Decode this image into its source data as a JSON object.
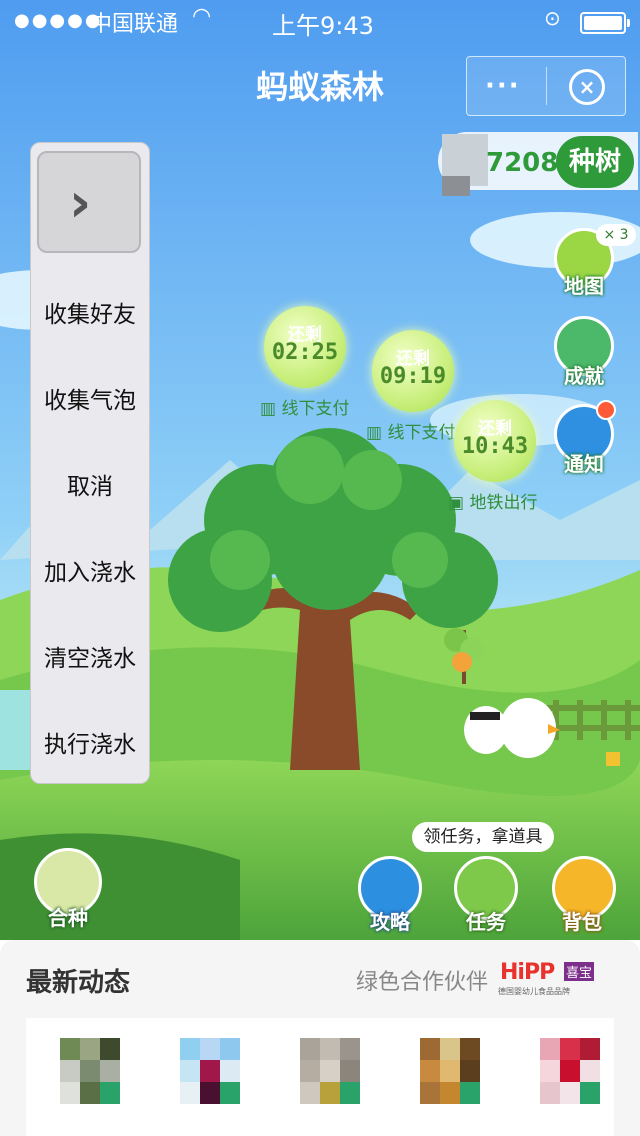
{
  "status_bar": {
    "signal": "●●●●●",
    "carrier": "中国联通",
    "time": "上午9:43"
  },
  "header": {
    "title": "蚂蚁森林",
    "more_label": "···"
  },
  "energy": {
    "value": "7208g",
    "plant_button": "种树"
  },
  "side_buttons": [
    {
      "label": "地图",
      "icon": "tree-icon",
      "badge": "× 3"
    },
    {
      "label": "成就",
      "icon": "certificate-icon"
    },
    {
      "label": "通知",
      "icon": "envelope-icon"
    }
  ],
  "bubbles": [
    {
      "top": "还剩",
      "time": "02:25",
      "note": "线下支付"
    },
    {
      "top": "还剩",
      "time": "09:19",
      "note": "线下支付"
    },
    {
      "top": "还剩",
      "time": "10:43",
      "note": "地铁出行"
    }
  ],
  "menu": {
    "items": [
      "收集好友",
      "收集气泡",
      "取消",
      "加入浇水",
      "清空浇水",
      "执行浇水"
    ]
  },
  "task_tip": "领任务，拿道具",
  "bottom_buttons": [
    {
      "label": "合种",
      "icon": "tree-icon"
    },
    {
      "label": "攻略",
      "icon": "book-icon"
    },
    {
      "label": "任务",
      "icon": "clipboard-icon"
    },
    {
      "label": "背包",
      "icon": "backpack-icon"
    }
  ],
  "feed": {
    "title": "最新动态",
    "partner_label": "绿色合作伙伴",
    "partner_logo": "HiPP",
    "partner_logo_sub": "喜宝",
    "partner_caption": "德国婴幼儿食品品牌"
  },
  "colors": {
    "sky_top": "#4f9cf0",
    "grass": "#6cc24a",
    "accent_green": "#2f9a3a"
  }
}
